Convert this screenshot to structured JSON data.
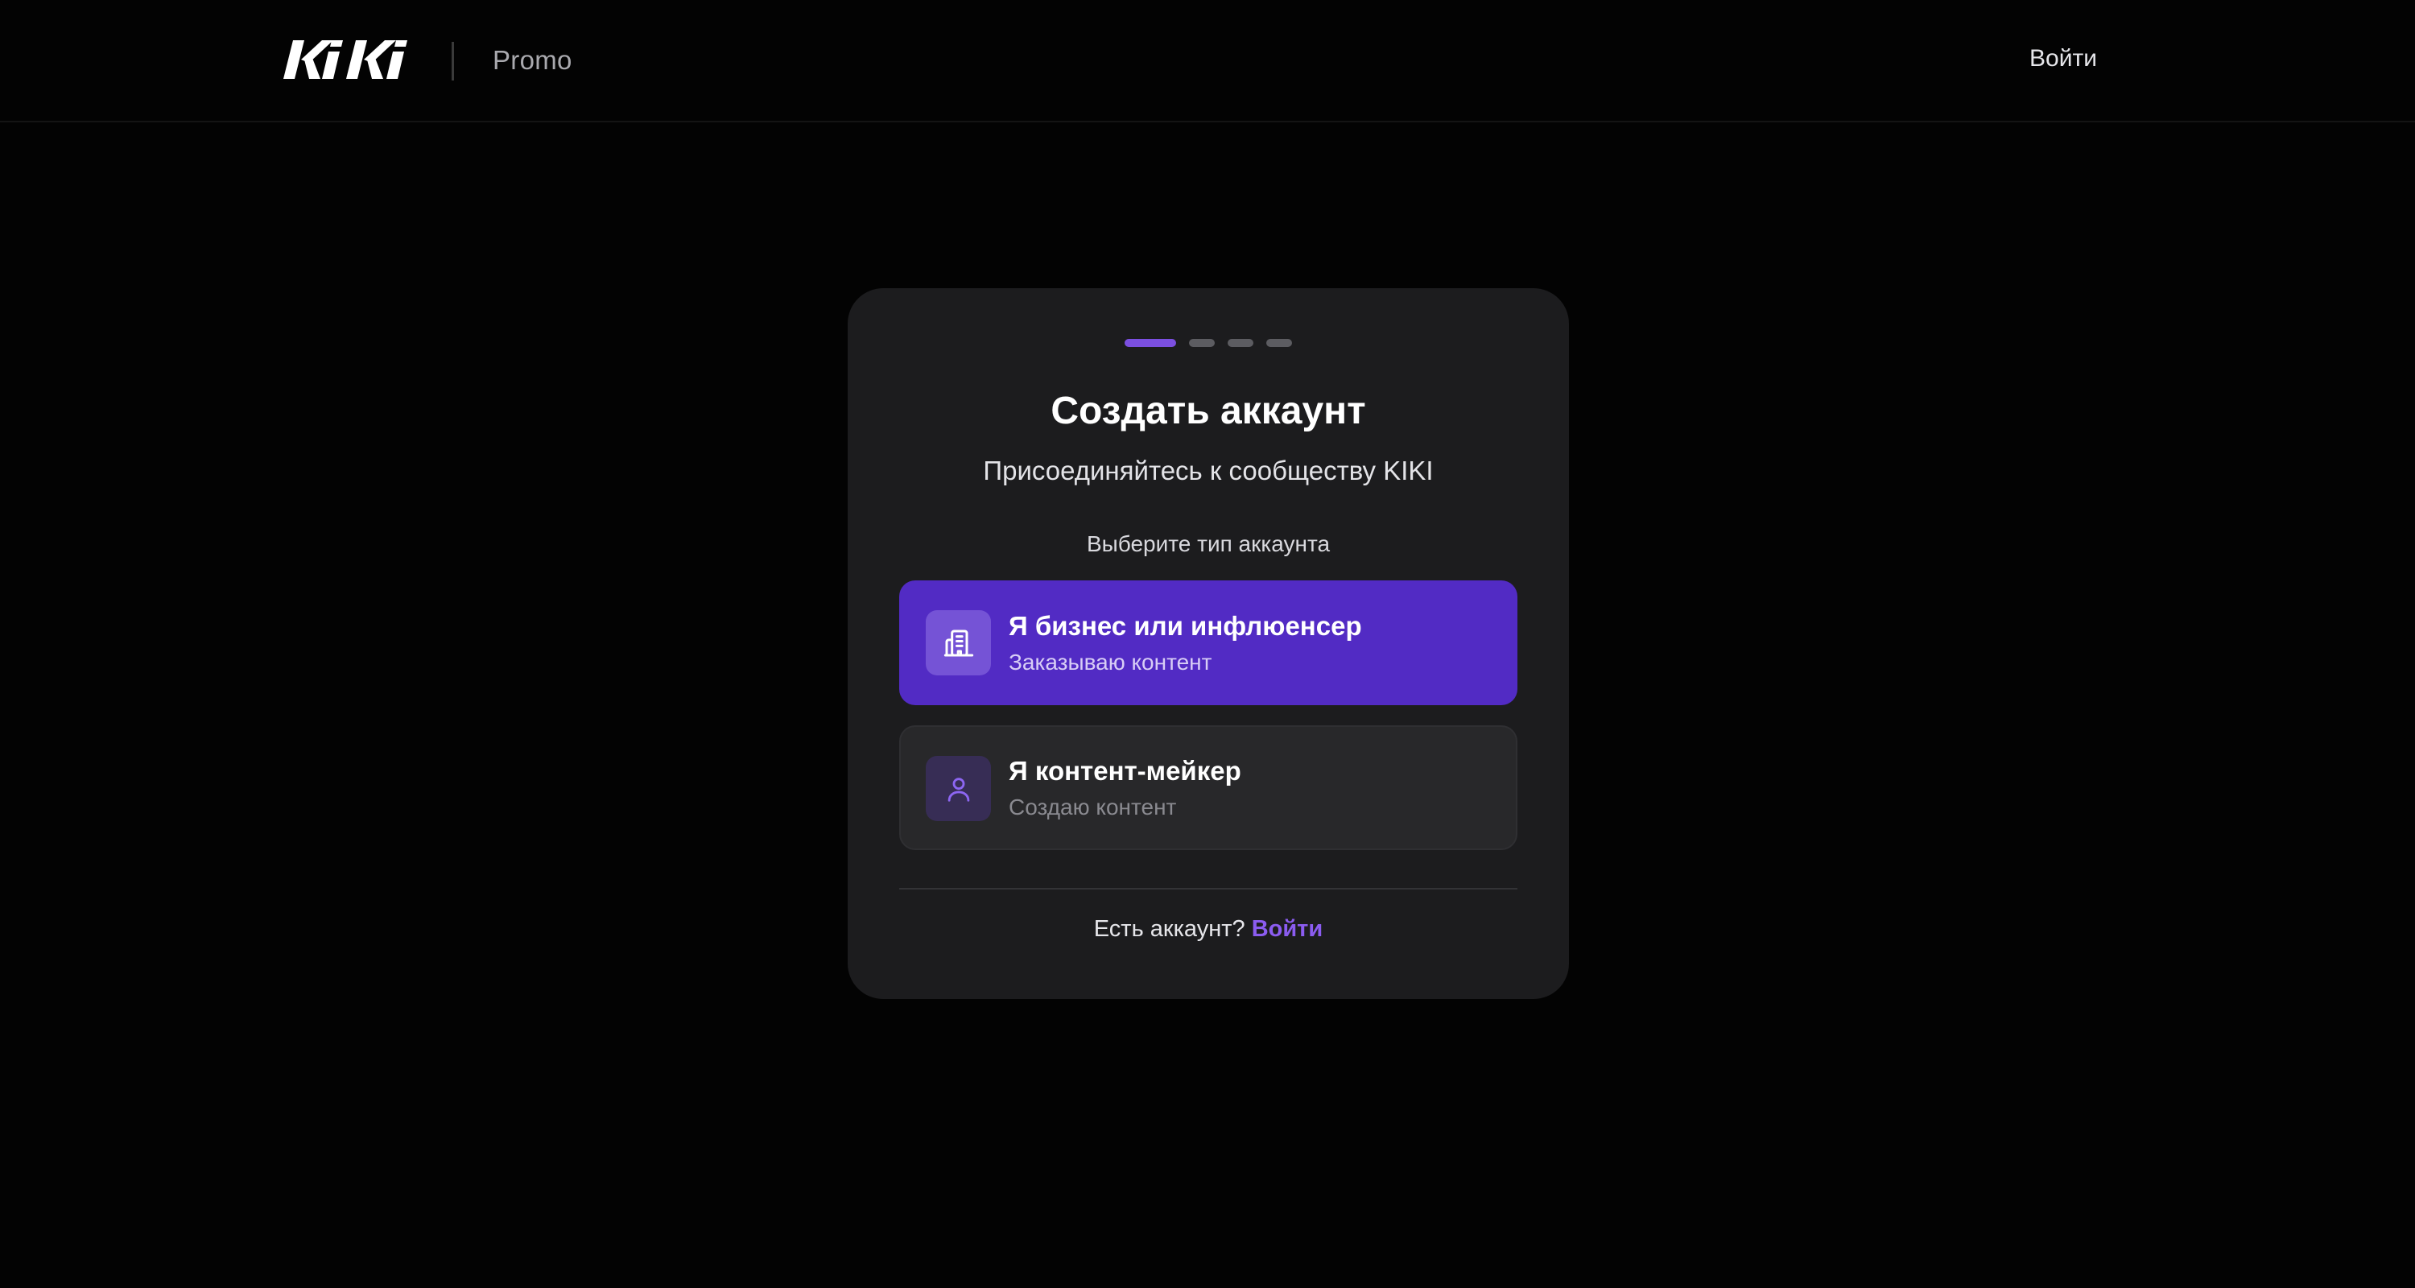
{
  "header": {
    "brand": "KIKI",
    "section": "Promo",
    "login_label": "Войти"
  },
  "card": {
    "steps_total": 4,
    "step_current": 1,
    "title": "Создать аккаунт",
    "subtitle": "Присоединяйтесь к сообществу KIKI",
    "choose_label": "Выберите тип аккаунта",
    "options": [
      {
        "title": "Я бизнес или инфлюенсер",
        "description": "Заказываю контент",
        "icon": "building-icon",
        "selected": true
      },
      {
        "title": "Я контент-мейкер",
        "description": "Создаю контент",
        "icon": "user-icon",
        "selected": false
      }
    ],
    "footer": {
      "question": "Есть аккаунт?",
      "link_label": "Войти"
    }
  },
  "colors": {
    "background": "#030303",
    "card": "#1c1c1e",
    "accent": "#7b4fe0",
    "selected_option": "#522bc4",
    "link": "#8b5cf0"
  }
}
